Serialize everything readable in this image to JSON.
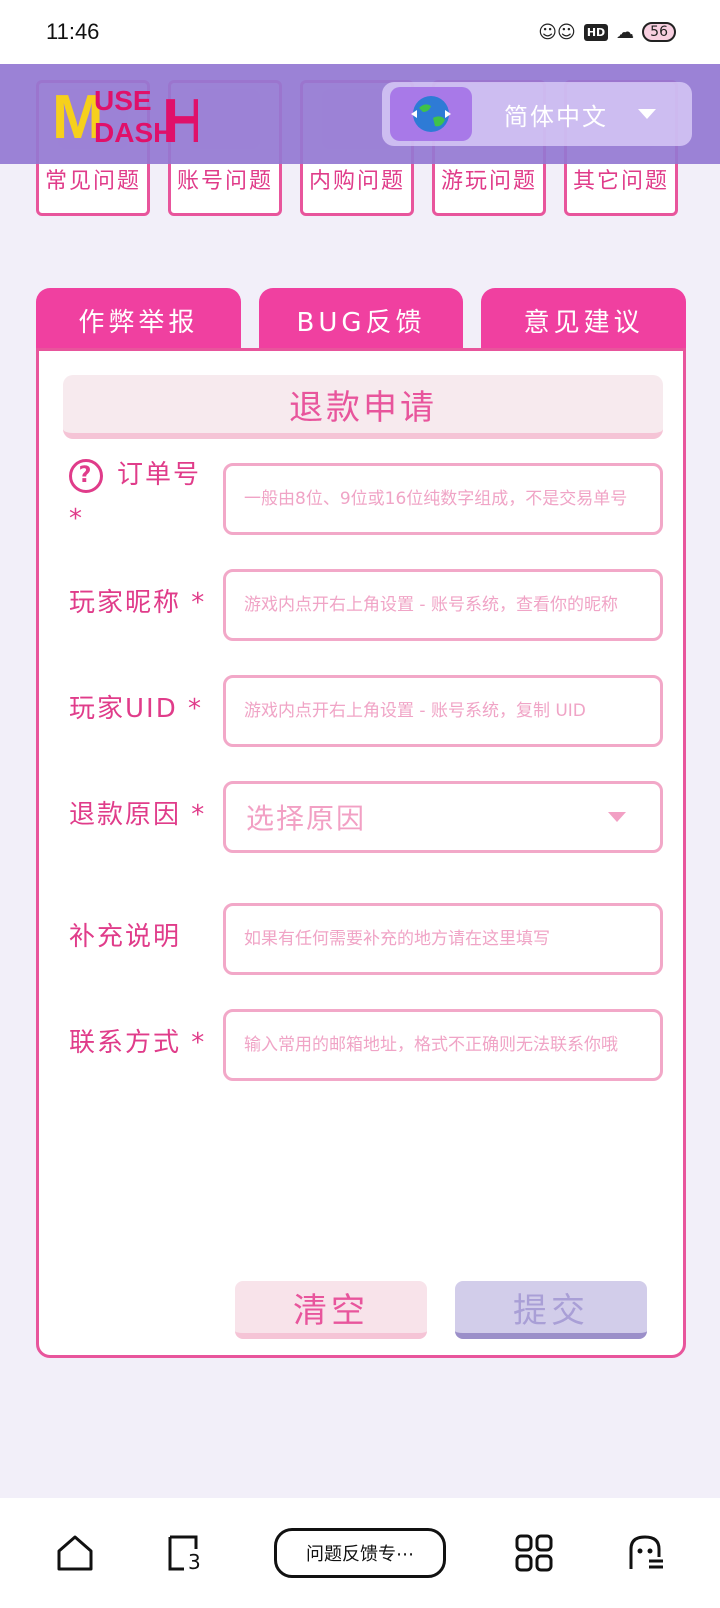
{
  "status_bar": {
    "time": "11:46",
    "hd": "HD",
    "battery": "56"
  },
  "header": {
    "logo_text_top": "USE",
    "logo_text_bottom": "DASH",
    "language": "简体中文"
  },
  "categories": [
    {
      "label": "常见问题"
    },
    {
      "label": "账号问题"
    },
    {
      "label": "内购问题"
    },
    {
      "label": "游玩问题"
    },
    {
      "label": "其它问题"
    }
  ],
  "tabs": [
    {
      "label": "作弊举报"
    },
    {
      "label": "BUG反馈"
    },
    {
      "label": "意见建议"
    }
  ],
  "form": {
    "title": "退款申请",
    "order_label": "订单号 *",
    "order_placeholder": "一般由8位、9位或16位纯数字组成，不是交易单号",
    "nickname_label": "玩家昵称 *",
    "nickname_placeholder": "游戏内点开右上角设置 - 账号系统，查看你的昵称",
    "uid_label": "玩家UID *",
    "uid_placeholder": "游戏内点开右上角设置 - 账号系统，复制 UID",
    "reason_label": "退款原因 *",
    "reason_value": "选择原因",
    "note_label": "补充说明",
    "note_placeholder": "如果有任何需要补充的地方请在这里填写",
    "contact_label": "联系方式 *",
    "contact_placeholder": "输入常用的邮箱地址，格式不正确则无法联系你哦",
    "clear_label": "清空",
    "submit_label": "提交"
  },
  "bottom_nav": {
    "center_label": "问题反馈专⋯"
  }
}
